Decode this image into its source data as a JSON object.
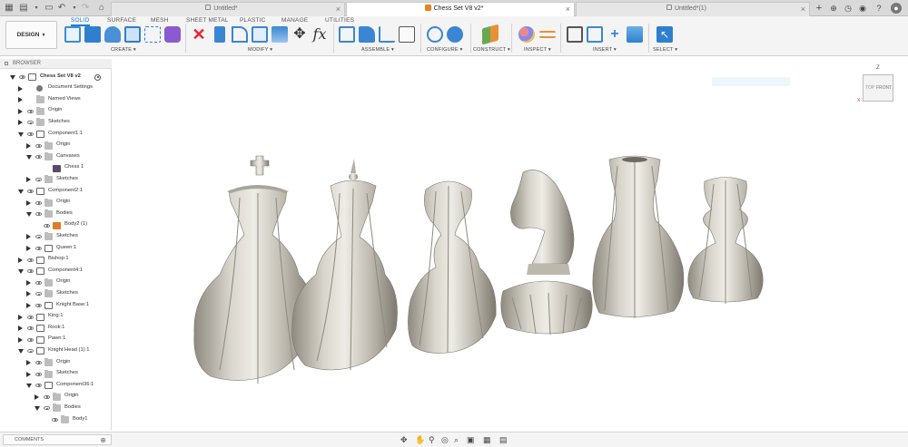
{
  "tabs": {
    "tab1": "Untitled*",
    "tab2": "Chess Set V8 v2*",
    "tab3": "Untitled*(1)"
  },
  "ribbon": {
    "tabs": [
      "SOLID",
      "SURFACE",
      "MESH",
      "SHEET METAL",
      "PLASTIC",
      "MANAGE",
      "UTILITIES"
    ],
    "workspace": "DESIGN",
    "groups": [
      "CREATE",
      "MODIFY",
      "ASSEMBLE",
      "CONFIGURE",
      "CONSTRUCT",
      "INSPECT",
      "INSERT",
      "SELECT"
    ]
  },
  "browser": {
    "title": "BROWSER",
    "items": [
      "Chess Set V8 v2",
      "Document Settings",
      "Named Views",
      "Origin",
      "Sketches",
      "Component1:1",
      "Origin",
      "Canvases",
      "Chess 1",
      "Sketches",
      "Component2:1",
      "Origin",
      "Bodies",
      "Body2 (1)",
      "Sketches",
      "Queen:1",
      "Bishop:1",
      "Component4:1",
      "Origin",
      "Sketches",
      "Knight Base:1",
      "King:1",
      "Rook:1",
      "Pawn:1",
      "Knight Head (1):1",
      "Origin",
      "Sketches",
      "Component36:1",
      "Origin",
      "Bodies",
      "Body1"
    ]
  },
  "comments": {
    "label": "COMMENTS"
  },
  "viewcube": {
    "front": "FRONT",
    "top": "TOP",
    "z": "Z",
    "x": "X"
  },
  "colors": {
    "accent": "#1f7fd3",
    "orange": "#e9831f",
    "piece": "#c9c6bd"
  }
}
